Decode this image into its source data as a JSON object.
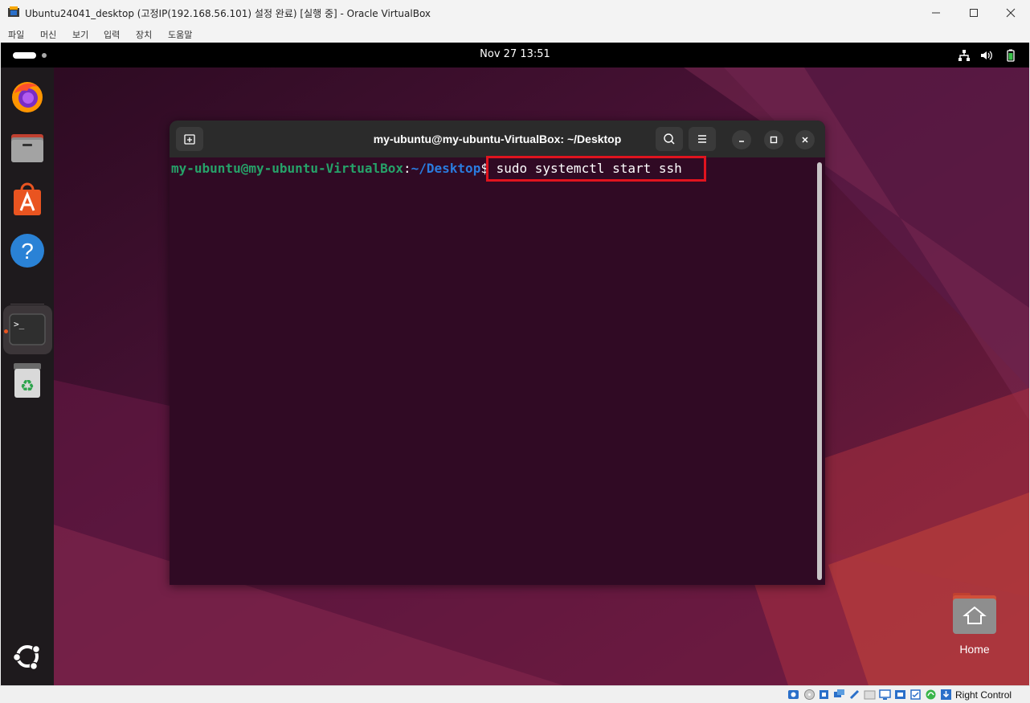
{
  "window": {
    "title": "Ubuntu24041_desktop (고정IP(192.168.56.101) 설정 완료) [실행 중] - Oracle VirtualBox",
    "menu": [
      "파일",
      "머신",
      "보기",
      "입력",
      "장치",
      "도움말"
    ],
    "controls": [
      "minimize-icon",
      "maximize-icon",
      "close-icon"
    ]
  },
  "ubuntu": {
    "clock": "Nov 27  13:51",
    "tray_icons": [
      "network-icon",
      "volume-icon",
      "battery-icon"
    ],
    "dock": [
      {
        "name": "Firefox",
        "icon": "firefox-icon"
      },
      {
        "name": "Files",
        "icon": "files-icon"
      },
      {
        "name": "App Center",
        "icon": "app-center-icon"
      },
      {
        "name": "Help",
        "icon": "help-icon"
      },
      {
        "name": "Terminal",
        "icon": "terminal-icon",
        "active": true
      },
      {
        "name": "Trash",
        "icon": "trash-icon"
      }
    ],
    "show_apps_icon": "ubuntu-logo-icon",
    "desktop_icons": [
      {
        "label": "Home",
        "icon": "home-folder-icon"
      }
    ]
  },
  "terminal": {
    "title": "my-ubuntu@my-ubuntu-VirtualBox: ~/Desktop",
    "prompt_user": "my-ubuntu@my-ubuntu-VirtualBox",
    "prompt_colon": ":",
    "prompt_path": "~/Desktop",
    "prompt_symbol": "$",
    "command": " sudo systemctl start ssh",
    "highlight_color": "#e0141e"
  },
  "status_bar": {
    "host_key": "Right Control"
  },
  "colors": {
    "terminal_bg": "#300a24",
    "prompt_user": "#26a269",
    "prompt_path": "#2a7bde",
    "accent": "#e95420"
  }
}
